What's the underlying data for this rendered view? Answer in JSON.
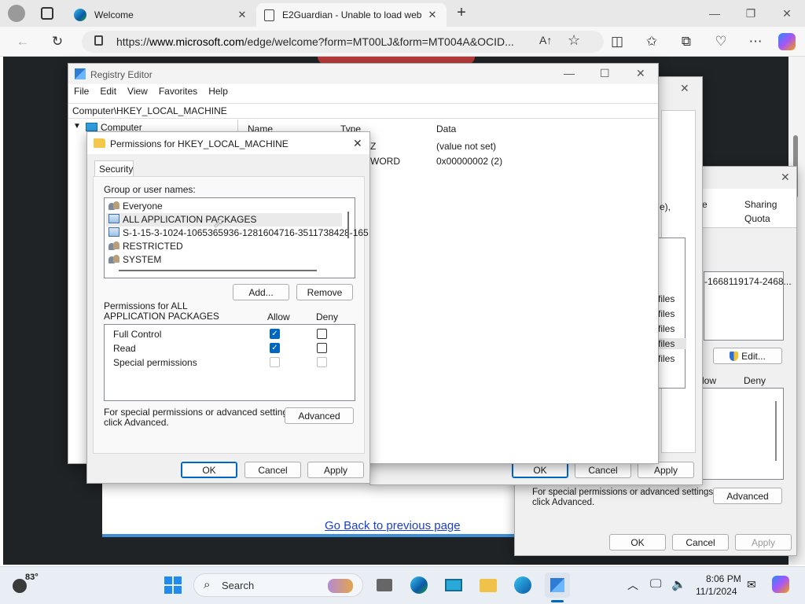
{
  "browser": {
    "tabs": [
      {
        "title": "Welcome",
        "active": false
      },
      {
        "title": "E2Guardian - Unable to load web",
        "active": true
      }
    ],
    "url_prefix": "https://",
    "url_host": "www.microsoft.com",
    "url_path": "/edge/welcome?form=MT00LJ&form=MT004A&OCID...",
    "page_link": "Go Back to previous page"
  },
  "registry_editor": {
    "title": "Registry Editor",
    "menu": [
      "File",
      "Edit",
      "View",
      "Favorites",
      "Help"
    ],
    "path": "Computer\\HKEY_LOCAL_MACHINE",
    "tree_root": "Computer",
    "columns": [
      "Name",
      "Type",
      "Data"
    ],
    "rows": [
      {
        "type_fragment": "Z",
        "data": "(value not set)"
      },
      {
        "type_fragment": "WORD",
        "data": "0x00000002 (2)"
      }
    ]
  },
  "permissions_dialog": {
    "title": "Permissions for HKEY_LOCAL_MACHINE",
    "tab": "Security",
    "group_label": "Group or user names:",
    "groups": [
      {
        "name": "Everyone",
        "icon": "group-icon"
      },
      {
        "name": "ALL APPLICATION PACKAGES",
        "icon": "package-icon"
      },
      {
        "name": "S-1-15-3-1024-1065365936-1281604716-3511738428-165",
        "icon": "package-icon"
      },
      {
        "name": "RESTRICTED",
        "icon": "group-icon"
      },
      {
        "name": "SYSTEM",
        "icon": "group-icon"
      }
    ],
    "add_label": "Add...",
    "remove_label": "Remove",
    "perm_label_line1": "Permissions for ALL",
    "perm_label_line2": "APPLICATION PACKAGES",
    "allow_label": "Allow",
    "deny_label": "Deny",
    "permissions": [
      {
        "name": "Full Control",
        "allow": true,
        "deny": false
      },
      {
        "name": "Read",
        "allow": true,
        "deny": false
      },
      {
        "name": "Special permissions",
        "allow": false,
        "deny": false
      }
    ],
    "special_text_line1": "For special permissions or advanced settings,",
    "special_text_line2": "click Advanced.",
    "advanced_label": "Advanced",
    "ok_label": "OK",
    "cancel_label": "Cancel",
    "apply_label": "Apply"
  },
  "background_dialog": {
    "tab_sharing": "Sharing",
    "tab_quota": "Quota",
    "tab_frag": "e",
    "frag_paren": "e),",
    "files_rows": [
      "files",
      "files",
      "files",
      "files",
      "files"
    ],
    "sid_fragment": "-1668119174-2468...",
    "edit_label": "Edit...",
    "allow_frag": "low",
    "deny_label": "Deny",
    "special_text_line1": "For special permissions or advanced settings,",
    "special_text_line2": "click Advanced.",
    "advanced_label": "Advanced",
    "ok_label": "OK",
    "cancel_label": "Cancel",
    "apply_label": "Apply",
    "mid_ok_label": "OK",
    "mid_cancel_label": "Cancel",
    "mid_apply_label": "Apply"
  },
  "taskbar": {
    "weather_temp": "83°",
    "search_placeholder": "Search",
    "time": "8:06 PM",
    "date": "11/1/2024"
  }
}
